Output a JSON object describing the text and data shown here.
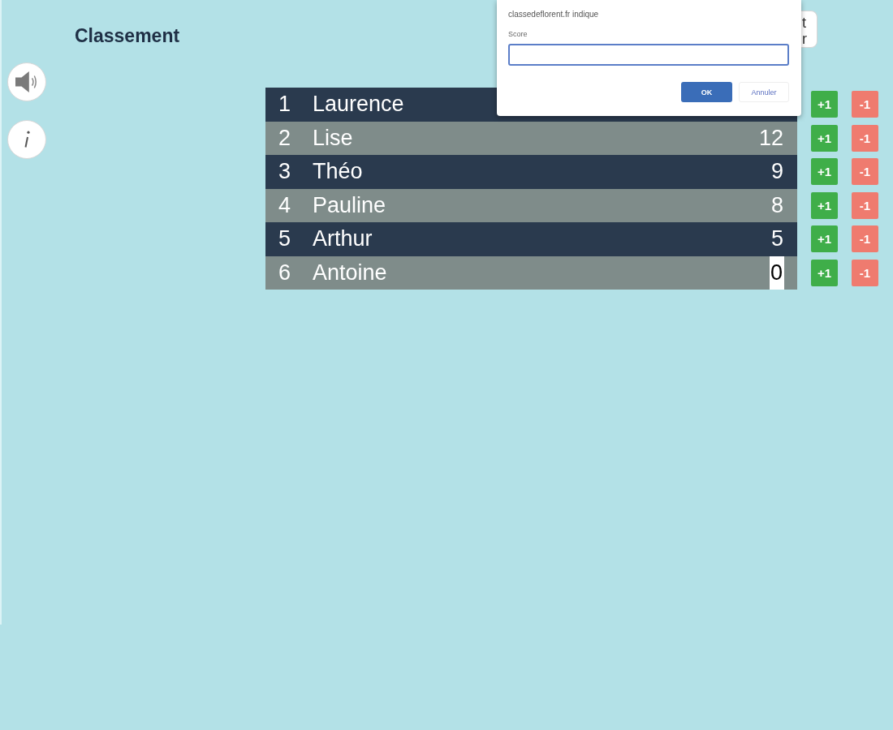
{
  "title": "Classement",
  "players": [
    {
      "rank": "1",
      "name": "Laurence",
      "editing": false,
      "plus_button": "+1",
      "minus_button": "-1"
    },
    {
      "rank": "2",
      "name": "Lise",
      "score": "12",
      "editing": false,
      "plus_button": "+1",
      "minus_button": "-1"
    },
    {
      "rank": "3",
      "name": "Théo",
      "score": "9",
      "editing": false,
      "plus_button": "+1",
      "minus_button": "-1"
    },
    {
      "rank": "4",
      "name": "Pauline",
      "score": "8",
      "editing": false,
      "plus_button": "+1",
      "minus_button": "-1"
    },
    {
      "rank": "5",
      "name": "Arthur",
      "score": "5",
      "editing": false,
      "plus_button": "+1",
      "minus_button": "-1"
    },
    {
      "rank": "6",
      "name": "Antoine",
      "score": "0",
      "editing": true,
      "plus_button": "+1",
      "minus_button": "-1"
    }
  ],
  "background_button": {
    "lines": [
      "t",
      "r"
    ]
  },
  "dialog": {
    "origin": "classedeflorent.fr indique",
    "label": "Score",
    "focused": true,
    "buttons": [
      {
        "label": "OK",
        "kind": "primary"
      },
      {
        "label": "Annuler",
        "kind": "secondary"
      }
    ]
  }
}
